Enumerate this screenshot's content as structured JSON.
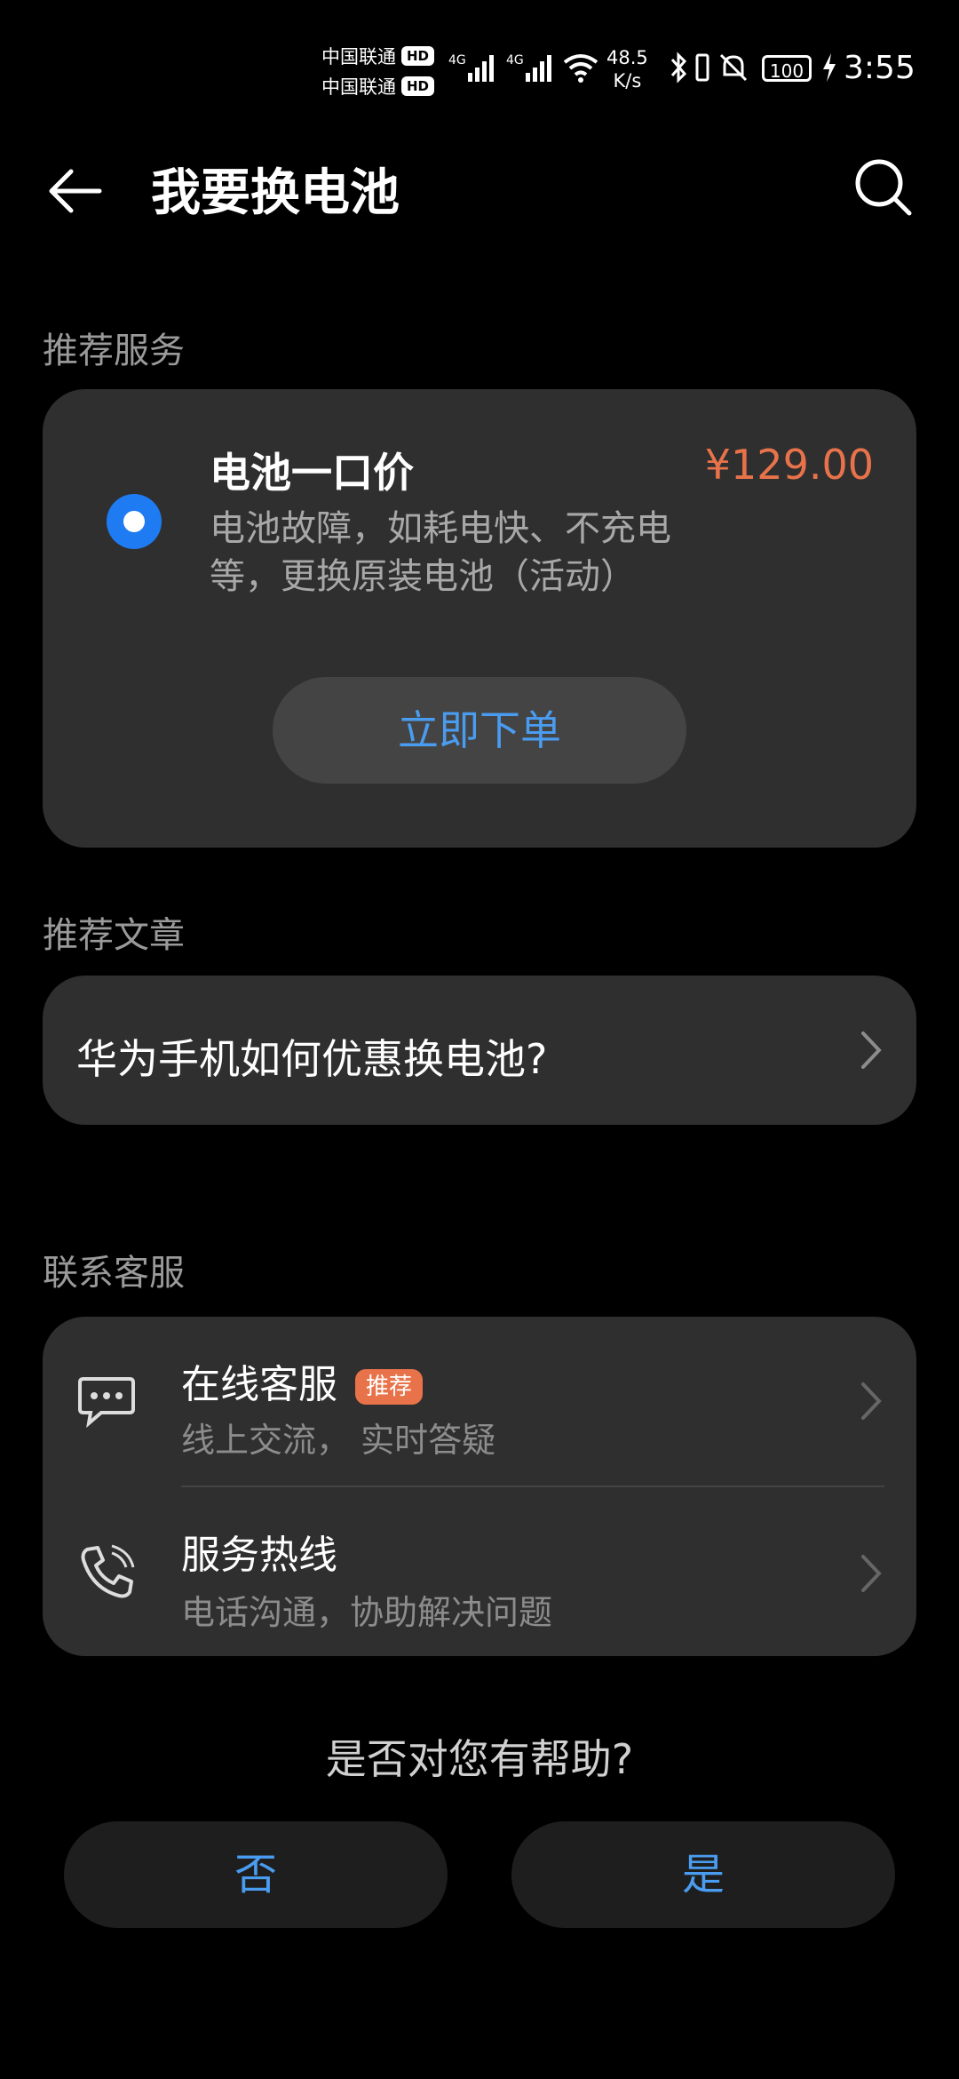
{
  "status_bar": {
    "carrier1": "中国联通",
    "carrier2": "中国联通",
    "hd": "HD",
    "net": "4G",
    "speed_value": "48.5",
    "speed_unit": "K/s",
    "battery": "100",
    "time": "3:55"
  },
  "header": {
    "title": "我要换电池"
  },
  "recommended_service": {
    "section_label": "推荐服务",
    "title": "电池一口价",
    "price": "¥129.00",
    "description": "电池故障，如耗电快、不充电等，更换原装电池（活动）",
    "order_button": "立即下单"
  },
  "recommended_article": {
    "section_label": "推荐文章",
    "title": "华为手机如何优惠换电池?"
  },
  "contact": {
    "section_label": "联系客服",
    "items": [
      {
        "title": "在线客服",
        "badge": "推荐",
        "subtitle": "线上交流， 实时答疑",
        "icon": "chat-bubble-icon"
      },
      {
        "title": "服务热线",
        "subtitle": "电话沟通，协助解决问题",
        "icon": "phone-icon"
      }
    ]
  },
  "feedback": {
    "question": "是否对您有帮助?",
    "no": "否",
    "yes": "是"
  },
  "colors": {
    "accent": "#4a9cf0",
    "price": "#e8734a",
    "radio": "#1f7bf2",
    "card": "#2f2f2f"
  }
}
